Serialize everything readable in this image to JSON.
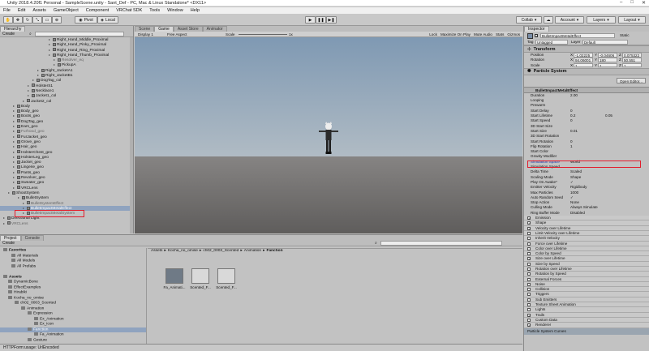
{
  "window": {
    "title": "Unity 2018.4.20f1 Personal - SampleScene.unity - Sant_Def - PC, Mac & Linux Standalone* <DX11>"
  },
  "menu": [
    "File",
    "Edit",
    "Assets",
    "GameObject",
    "Component",
    "VRChat SDK",
    "Tools",
    "Window",
    "Help"
  ],
  "toolbar": {
    "pivot": "Pivot",
    "local": "Local",
    "collab": "Collab",
    "account": "Account",
    "layers": "Layers",
    "layout": "Layout"
  },
  "hierarchy": {
    "tab": "Hierarchy",
    "create": "Create",
    "rows": [
      {
        "indent": 60,
        "label": "Right_Hand_Middle_Proximal",
        "dim": false
      },
      {
        "indent": 60,
        "label": "Right_Hand_Pinky_Proximal",
        "dim": false
      },
      {
        "indent": 60,
        "label": "Right_Hand_Ring_Proximal",
        "dim": false
      },
      {
        "indent": 60,
        "label": "Right_Hand_Thumb_Proximal",
        "dim": false
      },
      {
        "indent": 66,
        "label": "Resolver_eq",
        "dim": true
      },
      {
        "indent": 66,
        "label": "PickupA",
        "dim": false
      },
      {
        "indent": 46,
        "label": "Right_JacketA1",
        "dim": false
      },
      {
        "indent": 46,
        "label": "Right_JacketB1",
        "dim": false
      },
      {
        "indent": 40,
        "label": "DogTag_col",
        "dim": false
      },
      {
        "indent": 34,
        "label": "HolsterS1",
        "dim": false
      },
      {
        "indent": 34,
        "label": "Necklace1",
        "dim": false
      },
      {
        "indent": 34,
        "label": "Jacket1_col",
        "dim": false
      },
      {
        "indent": 28,
        "label": "Jacket2_col",
        "dim": false
      },
      {
        "indent": 16,
        "label": "Body",
        "dim": false
      },
      {
        "indent": 16,
        "label": "Body_geo",
        "dim": false
      },
      {
        "indent": 16,
        "label": "Boots_geo",
        "dim": false
      },
      {
        "indent": 16,
        "label": "DogTag_geo",
        "dim": false
      },
      {
        "indent": 16,
        "label": "Ears_geo",
        "dim": false
      },
      {
        "indent": 16,
        "label": "Furhood_geo",
        "dim": true
      },
      {
        "indent": 16,
        "label": "FurJacket_geo",
        "dim": false
      },
      {
        "indent": 16,
        "label": "Grove_geo",
        "dim": false
      },
      {
        "indent": 16,
        "label": "Hair_geo",
        "dim": false
      },
      {
        "indent": 16,
        "label": "HolsterChest_geo",
        "dim": false
      },
      {
        "indent": 16,
        "label": "HolsterLeg_geo",
        "dim": false
      },
      {
        "indent": 16,
        "label": "Jacket_geo",
        "dim": false
      },
      {
        "indent": 16,
        "label": "Lingerie_geo",
        "dim": false
      },
      {
        "indent": 16,
        "label": "Pants_geo",
        "dim": false
      },
      {
        "indent": 16,
        "label": "Revolver_geo",
        "dim": false
      },
      {
        "indent": 16,
        "label": "Sweater_geo",
        "dim": false
      },
      {
        "indent": 16,
        "label": "VRCLens",
        "dim": false
      },
      {
        "indent": 10,
        "label": "ShootSystem",
        "dim": false
      },
      {
        "indent": 22,
        "label": "BulletSystem",
        "dim": false
      },
      {
        "indent": 28,
        "label": "BulletSystemEffect",
        "dim": true
      },
      {
        "indent": 28,
        "label": "BulletImpactMetalEffect",
        "dim": false,
        "selected": true
      },
      {
        "indent": 28,
        "label": "BulletImpactMetalSystem",
        "dim": true
      },
      {
        "indent": 4,
        "label": "Directional Light",
        "dim": false
      },
      {
        "indent": 4,
        "label": "VRCLens",
        "dim": true
      }
    ]
  },
  "scene": {
    "tabs": [
      "Scene",
      "Game",
      "Asset Store",
      "Animator"
    ],
    "display": "Display 1",
    "aspect": "Free Aspect",
    "scale_label": "Scale",
    "scale_value": "1x",
    "right_opts": [
      "Lock",
      "Maximize On Play",
      "Mute Audio",
      "Stats",
      "Gizmos"
    ]
  },
  "inspector": {
    "tab": "Inspector",
    "object_name": "BulletImpactMetalEffect",
    "static": "Static",
    "tag_label": "Tag",
    "tag": "Untagged",
    "layer_label": "Layer",
    "layer": "Default",
    "transform": {
      "title": "Transform",
      "position": {
        "label": "Position",
        "x": "-1.02225",
        "y": "-0.04606",
        "z": "0.075322"
      },
      "rotation": {
        "label": "Rotation",
        "x": "94.06001",
        "y": "180",
        "z": "50.551"
      },
      "scale": {
        "label": "Scale",
        "x": "1",
        "y": "1",
        "z": "1"
      }
    },
    "particle": {
      "title": "Particle System",
      "subname": "BulletImpactMetalEffect",
      "open_editor": "Open Editor...",
      "props": [
        {
          "label": "Duration",
          "value": "2.00"
        },
        {
          "label": "Looping",
          "value": ""
        },
        {
          "label": "Prewarm",
          "value": ""
        },
        {
          "label": "Start Delay",
          "value": "0"
        },
        {
          "label": "Start Lifetime",
          "value": "0.2",
          "value2": "0.05"
        },
        {
          "label": "Start Speed",
          "value": "0"
        },
        {
          "label": "3D Start Size",
          "value": ""
        },
        {
          "label": "Start Size",
          "value": "0.01"
        },
        {
          "label": "3D Start Rotation",
          "value": ""
        },
        {
          "label": "Start Rotation",
          "value": "0"
        },
        {
          "label": "Flip Rotation",
          "value": "1"
        },
        {
          "label": "Start Color",
          "value": ""
        },
        {
          "label": "Gravity Modifier",
          "value": ""
        },
        {
          "label": "Simulation Space",
          "value": "World",
          "highlight": true
        },
        {
          "label": "Simulation Speed",
          "value": ""
        },
        {
          "label": "Delta Time",
          "value": "Scaled"
        },
        {
          "label": "Scaling Mode",
          "value": "Shape"
        },
        {
          "label": "Play On Awake*",
          "value": "✓"
        },
        {
          "label": "Emitter Velocity",
          "value": "Rigidbody"
        },
        {
          "label": "Max Particles",
          "value": "1000"
        },
        {
          "label": "Auto Random Seed",
          "value": "✓"
        },
        {
          "label": "Stop Action",
          "value": "None"
        },
        {
          "label": "Culling Mode",
          "value": "Always Simulate"
        },
        {
          "label": "Ring Buffer Mode",
          "value": "Disabled"
        }
      ],
      "modules": [
        {
          "label": "Emission",
          "checked": true
        },
        {
          "label": "Shape",
          "checked": true
        },
        {
          "label": "Velocity over Lifetime",
          "checked": true
        },
        {
          "label": "Limit Velocity over Lifetime",
          "checked": false
        },
        {
          "label": "Inherit Velocity",
          "checked": false
        },
        {
          "label": "Force over Lifetime",
          "checked": false
        },
        {
          "label": "Color over Lifetime",
          "checked": false
        },
        {
          "label": "Color by Speed",
          "checked": false
        },
        {
          "label": "Size over Lifetime",
          "checked": true
        },
        {
          "label": "Size by Speed",
          "checked": false
        },
        {
          "label": "Rotation over Lifetime",
          "checked": false
        },
        {
          "label": "Rotation by Speed",
          "checked": false
        },
        {
          "label": "External Forces",
          "checked": false
        },
        {
          "label": "Noise",
          "checked": false
        },
        {
          "label": "Collision",
          "checked": false
        },
        {
          "label": "Triggers",
          "checked": false
        },
        {
          "label": "Sub Emitters",
          "checked": false
        },
        {
          "label": "Texture Sheet Animation",
          "checked": false
        },
        {
          "label": "Lights",
          "checked": false
        },
        {
          "label": "Trails",
          "checked": true
        },
        {
          "label": "Custom Data",
          "checked": false
        },
        {
          "label": "Renderer",
          "checked": true
        }
      ],
      "curves_label": "Particle System Curves"
    }
  },
  "project": {
    "tabs": [
      "Project",
      "Console"
    ],
    "create": "Create",
    "breadcrumb": [
      "Assets",
      "Kocha_no_omise",
      "ch02_0003_Scented",
      "Animation",
      "Fanction"
    ],
    "tree": [
      {
        "indent": 4,
        "label": "Favorites",
        "bold": true
      },
      {
        "indent": 14,
        "label": "All Materials"
      },
      {
        "indent": 14,
        "label": "All Models"
      },
      {
        "indent": 14,
        "label": "All Prefabs"
      },
      {
        "indent": 4,
        "label": ""
      },
      {
        "indent": 4,
        "label": "Assets",
        "bold": true
      },
      {
        "indent": 10,
        "label": "DynamicBone"
      },
      {
        "indent": 10,
        "label": "EffectExamples"
      },
      {
        "indent": 10,
        "label": "Hirabiki"
      },
      {
        "indent": 10,
        "label": "Kocha_no_omise"
      },
      {
        "indent": 18,
        "label": "ch02_0003_Scented"
      },
      {
        "indent": 26,
        "label": "Animation"
      },
      {
        "indent": 34,
        "label": "Expression"
      },
      {
        "indent": 42,
        "label": "Ex_Animation"
      },
      {
        "indent": 42,
        "label": "Ex_icon"
      },
      {
        "indent": 34,
        "label": "Fanction",
        "selected": true
      },
      {
        "indent": 42,
        "label": "Fa_Animation"
      },
      {
        "indent": 34,
        "label": "Gesture"
      }
    ],
    "assets": [
      {
        "label": "Fa_Animati...",
        "kind": "folder"
      },
      {
        "label": "Scented_F...",
        "kind": "controller"
      },
      {
        "label": "Scented_F...",
        "kind": "controller"
      }
    ]
  },
  "status": {
    "text": "HTTPForm:usage: UrlEncoded"
  }
}
